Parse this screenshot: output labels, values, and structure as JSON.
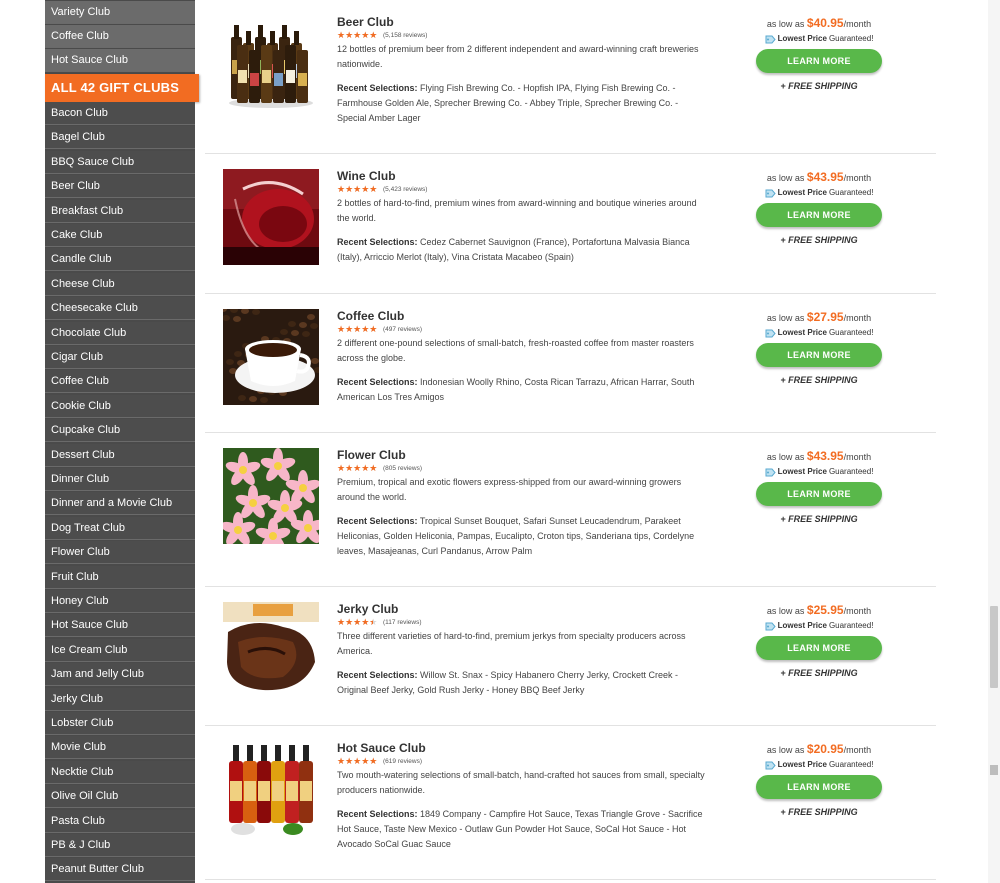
{
  "sidebar": {
    "top_items": [
      "Variety Club",
      "Coffee Club",
      "Hot Sauce Club"
    ],
    "all_clubs_label": "ALL 42 GIFT CLUBS",
    "items": [
      "Bacon Club",
      "Bagel Club",
      "BBQ Sauce Club",
      "Beer Club",
      "Breakfast Club",
      "Cake Club",
      "Candle Club",
      "Cheese Club",
      "Cheesecake Club",
      "Chocolate Club",
      "Cigar Club",
      "Coffee Club",
      "Cookie Club",
      "Cupcake Club",
      "Dessert Club",
      "Dinner Club",
      "Dinner and a Movie Club",
      "Dog Treat Club",
      "Flower Club",
      "Fruit Club",
      "Honey Club",
      "Hot Sauce Club",
      "Ice Cream Club",
      "Jam and Jelly Club",
      "Jerky Club",
      "Lobster Club",
      "Movie Club",
      "Necktie Club",
      "Olive Oil Club",
      "Pasta Club",
      "PB & J Club",
      "Peanut Butter Club"
    ]
  },
  "common": {
    "price_prefix": "as low as",
    "price_suffix": "/month",
    "lowest_price": "Lowest Price",
    "guaranteed": "Guaranteed!",
    "learn_more": "LEARN MORE",
    "free_shipping": "+ FREE SHIPPING",
    "recent_label": "Recent Selections:",
    "accent_color": "#f26c22",
    "button_color": "#59b84a",
    "sidebar_color": "#4d4d4d"
  },
  "listings": [
    {
      "title": "Beer Club",
      "image_icon": "beer-bottles-image",
      "rating": 4.5,
      "reviews": "(5,158 reviews)",
      "description": "12 bottles of premium beer from 2 different independent and award-winning craft breweries nationwide.",
      "recent_selections": "Flying Fish Brewing Co. - Hopfish IPA, Flying Fish Brewing Co. - Farmhouse Golden Ale, Sprecher Brewing Co. - Abbey Triple, Sprecher Brewing Co. - Special Amber Lager",
      "price": "$40.95"
    },
    {
      "title": "Wine Club",
      "image_icon": "wine-glass-image",
      "rating": 4.5,
      "reviews": "(5,423 reviews)",
      "description": "2 bottles of hard-to-find, premium wines from award-winning and boutique wineries around the world.",
      "recent_selections": "Cedez Cabernet Sauvignon (France), Portafortuna Malvasia Bianca (Italy), Arriccio Merlot (Italy), Vina Cristata Macabeo (Spain)",
      "price": "$43.95"
    },
    {
      "title": "Coffee Club",
      "image_icon": "coffee-cup-image",
      "rating": 4.5,
      "reviews": "(497 reviews)",
      "description": "2 different one-pound selections of small-batch, fresh-roasted coffee from master roasters across the globe.",
      "recent_selections": "Indonesian Woolly Rhino, Costa Rican Tarrazu, African Harrar, South American Los Tres Amigos",
      "price": "$27.95"
    },
    {
      "title": "Flower Club",
      "image_icon": "plumeria-flowers-image",
      "rating": 4.5,
      "reviews": "(805 reviews)",
      "description": "Premium, tropical and exotic flowers express-shipped from our award-winning growers around the world.",
      "recent_selections": "Tropical Sunset Bouquet, Safari Sunset Leucadendrum, Parakeet Heliconias, Golden Heliconia, Pampas, Eucalipto, Croton tips, Sanderiana tips, Cordelyne leaves, Masajeanas, Curl Pandanus, Arrow Palm",
      "price": "$43.95"
    },
    {
      "title": "Jerky Club",
      "image_icon": "jerky-image",
      "rating": 4,
      "reviews": "(117 reviews)",
      "description": "Three different varieties of hard-to-find, premium jerkys from specialty producers across America.",
      "recent_selections": "Willow St. Snax - Spicy Habanero Cherry Jerky, Crockett Creek - Original Beef Jerky, Gold Rush Jerky - Honey BBQ Beef Jerky",
      "price": "$25.95"
    },
    {
      "title": "Hot Sauce Club",
      "image_icon": "hot-sauce-bottles-image",
      "rating": 4.5,
      "reviews": "(619 reviews)",
      "description": "Two mouth-watering selections of small-batch, hand-crafted hot sauces from small, specialty producers nationwide.",
      "recent_selections": "1849 Company - Campfire Hot Sauce, Texas Triangle Grove - Sacrifice Hot Sauce, Taste New Mexico - Outlaw Gun Powder Hot Sauce, SoCal Hot Sauce - Hot Avocado SoCal Guac Sauce",
      "price": "$20.95"
    }
  ]
}
